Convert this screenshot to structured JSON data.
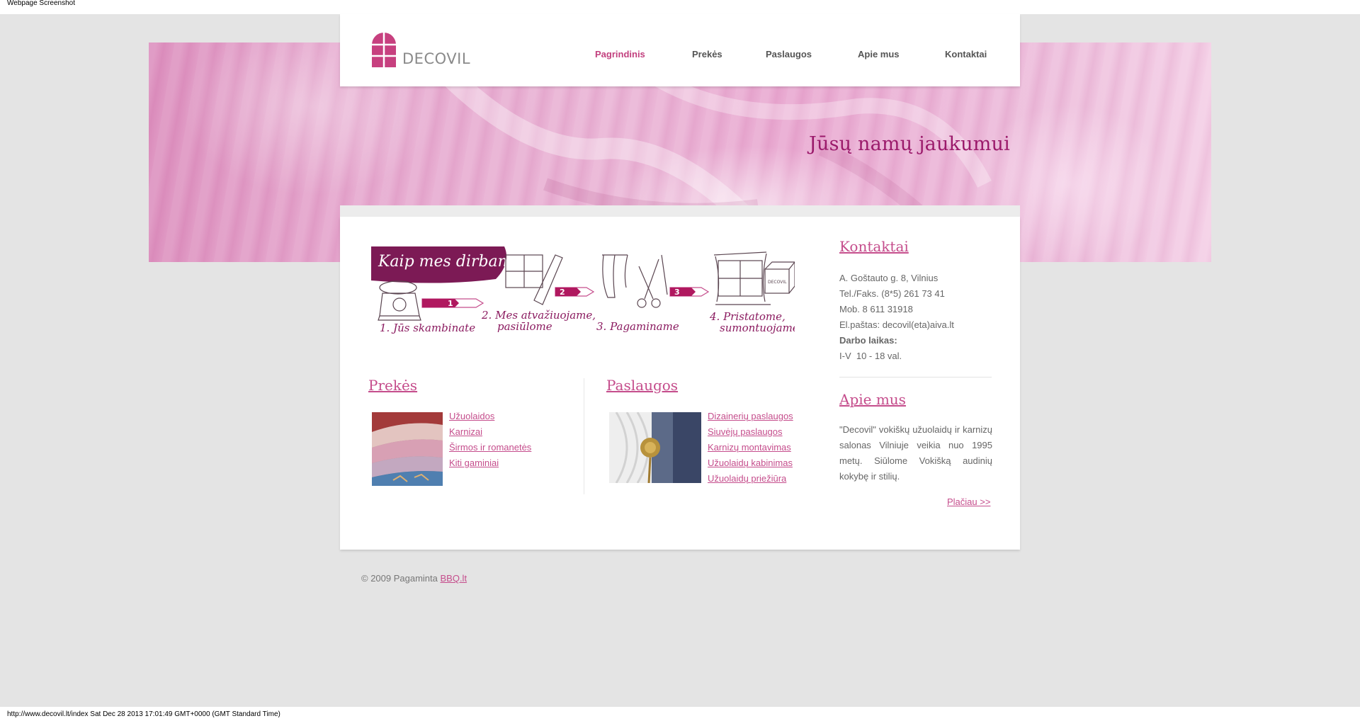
{
  "browser": {
    "caption": "Webpage Screenshot",
    "status_url": "http://www.decovil.lt/index Sat Dec 28 2013 17:01:49 GMT+0000 (GMT Standard Time)"
  },
  "brand": {
    "name": "DECOVIL",
    "accent": "#c54d8c",
    "slogan": "Jūsų namų jaukumui"
  },
  "nav": [
    {
      "label": "Pagrindinis",
      "active": true
    },
    {
      "label": "Prekės",
      "active": false
    },
    {
      "label": "Paslaugos",
      "active": false
    },
    {
      "label": "Apie mus",
      "active": false
    },
    {
      "label": "Kontaktai",
      "active": false
    }
  ],
  "how_we_work": {
    "title": "Kaip mes dirbame?",
    "steps": [
      {
        "number": "1",
        "text": "1. Jūs skambinate"
      },
      {
        "number": "2",
        "text_line1": "2. Mes atvažiuojame,",
        "text_line2": "pasiūlome"
      },
      {
        "number": "3",
        "text": "3. Pagaminame"
      },
      {
        "text_line1": "4. Pristatome,",
        "text_line2": "sumontuojame"
      }
    ],
    "box_label": "DECOVIL"
  },
  "products": {
    "title": "Prekės",
    "links": [
      "Užuolaidos",
      "Karnizai",
      "Širmos ir romanetės",
      "Kiti gaminiai"
    ]
  },
  "services": {
    "title": "Paslaugos",
    "links": [
      "Dizainerių paslaugos",
      "Siuvėjų paslaugos",
      "Karnizų montavimas",
      "Užuolaidų kabinimas",
      "Užuolaidų priežiūra"
    ]
  },
  "contacts": {
    "title": "Kontaktai",
    "address": "A. Goštauto g. 8, Vilnius",
    "phone": "Tel./Faks. (8*5) 261 73 41",
    "mobile": "Mob. 8 611 31918",
    "email": "El.paštas: decovil(eta)aiva.lt",
    "hours_label": "Darbo laikas:",
    "hours": "I-V  10 - 18 val."
  },
  "about": {
    "title": "Apie mus",
    "text": "\"Decovil\" vokiškų užuolaidų ir karnizų salonas Vilniuje veikia nuo 1995 metų. Siūlome Vokišką audinių kokybę ir stilių.",
    "more_label": "Plačiau >>"
  },
  "footer": {
    "text": "© 2009 Pagaminta ",
    "link_label": "BBQ.lt"
  }
}
